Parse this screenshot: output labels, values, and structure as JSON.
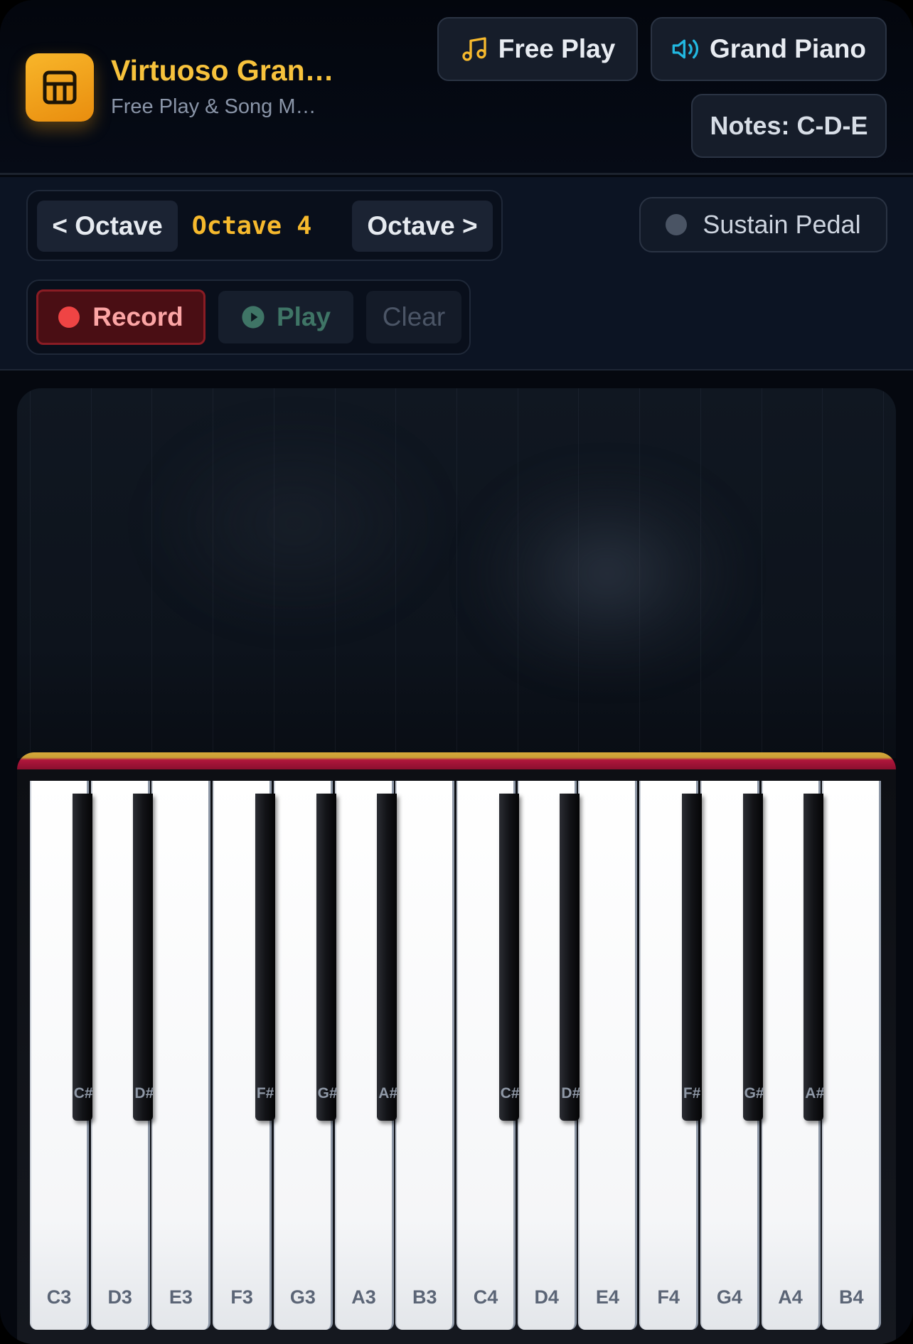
{
  "header": {
    "title": "Virtuoso Gran…",
    "subtitle": "Free Play & Song M…",
    "logo_icon": "piano-icon",
    "mode_label": "Free Play",
    "mode_icon": "music-note-icon",
    "instrument_label": "Grand Piano",
    "instrument_icon": "speaker-icon",
    "notes_label": "Notes: C-D-E"
  },
  "controls": {
    "octave_down_label": "< Octave",
    "octave_current": "Octave 4",
    "octave_up_label": "Octave >",
    "sustain_label": "Sustain Pedal",
    "record_label": "Record",
    "play_label": "Play",
    "clear_label": "Clear"
  },
  "colors": {
    "accent": "#f7c23c",
    "record": "#ef4444",
    "play": "#3f7566",
    "instrument_icon": "#22b8e0"
  },
  "piano": {
    "white_keys": [
      "C3",
      "D3",
      "E3",
      "F3",
      "G3",
      "A3",
      "B3",
      "C4",
      "D4",
      "E4",
      "F4",
      "G4",
      "A4",
      "B4"
    ],
    "black_keys": [
      "C#",
      "D#",
      "F#",
      "G#",
      "A#",
      "C#",
      "D#",
      "F#",
      "G#",
      "A#"
    ]
  }
}
